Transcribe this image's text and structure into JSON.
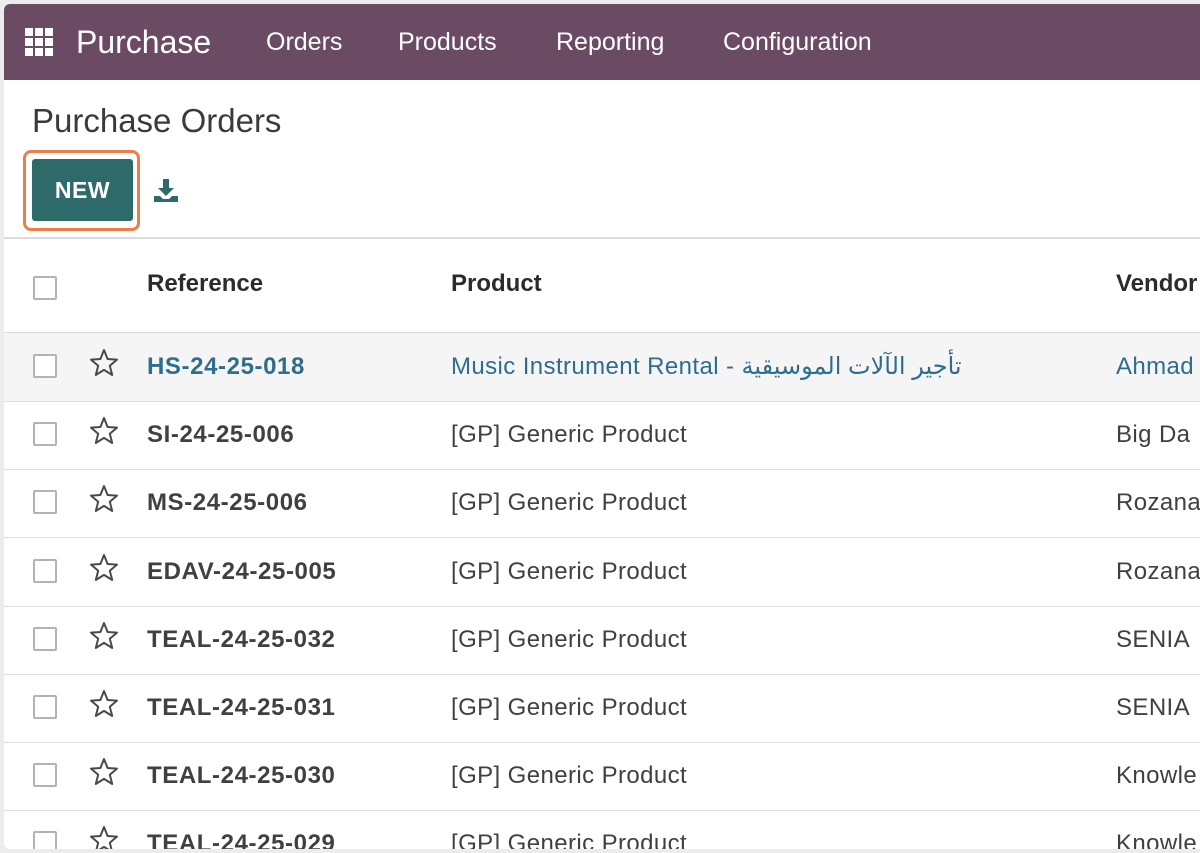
{
  "navbar": {
    "app_name": "Purchase",
    "apps_icon": "grid-apps-icon",
    "menu": [
      "Orders",
      "Products",
      "Reporting",
      "Configuration"
    ],
    "bg_color": "#6b4a64"
  },
  "control_panel": {
    "title": "Purchase Orders",
    "new_label": "NEW",
    "download_icon": "download-icon",
    "new_color": "#2f6a6b",
    "highlight_color": "#ee7d48"
  },
  "table": {
    "columns": [
      "Reference",
      "Product",
      "Vendor"
    ],
    "rows": [
      {
        "reference": "HS-24-25-018",
        "product": "Music Instrument Rental - تأجير الآلات الموسيقية",
        "vendor": "Ahmad",
        "highlighted": true
      },
      {
        "reference": "SI-24-25-006",
        "product": "[GP] Generic Product",
        "vendor": "Big Da"
      },
      {
        "reference": "MS-24-25-006",
        "product": "[GP] Generic Product",
        "vendor": "Rozana"
      },
      {
        "reference": "EDAV-24-25-005",
        "product": "[GP] Generic Product",
        "vendor": "Rozana"
      },
      {
        "reference": "TEAL-24-25-032",
        "product": "[GP] Generic Product",
        "vendor": "SENIA"
      },
      {
        "reference": "TEAL-24-25-031",
        "product": "[GP] Generic Product",
        "vendor": "SENIA"
      },
      {
        "reference": "TEAL-24-25-030",
        "product": "[GP] Generic Product",
        "vendor": "Knowle"
      },
      {
        "reference": "TEAL-24-25-029",
        "product": "[GP] Generic Product",
        "vendor": "Knowle"
      }
    ]
  }
}
